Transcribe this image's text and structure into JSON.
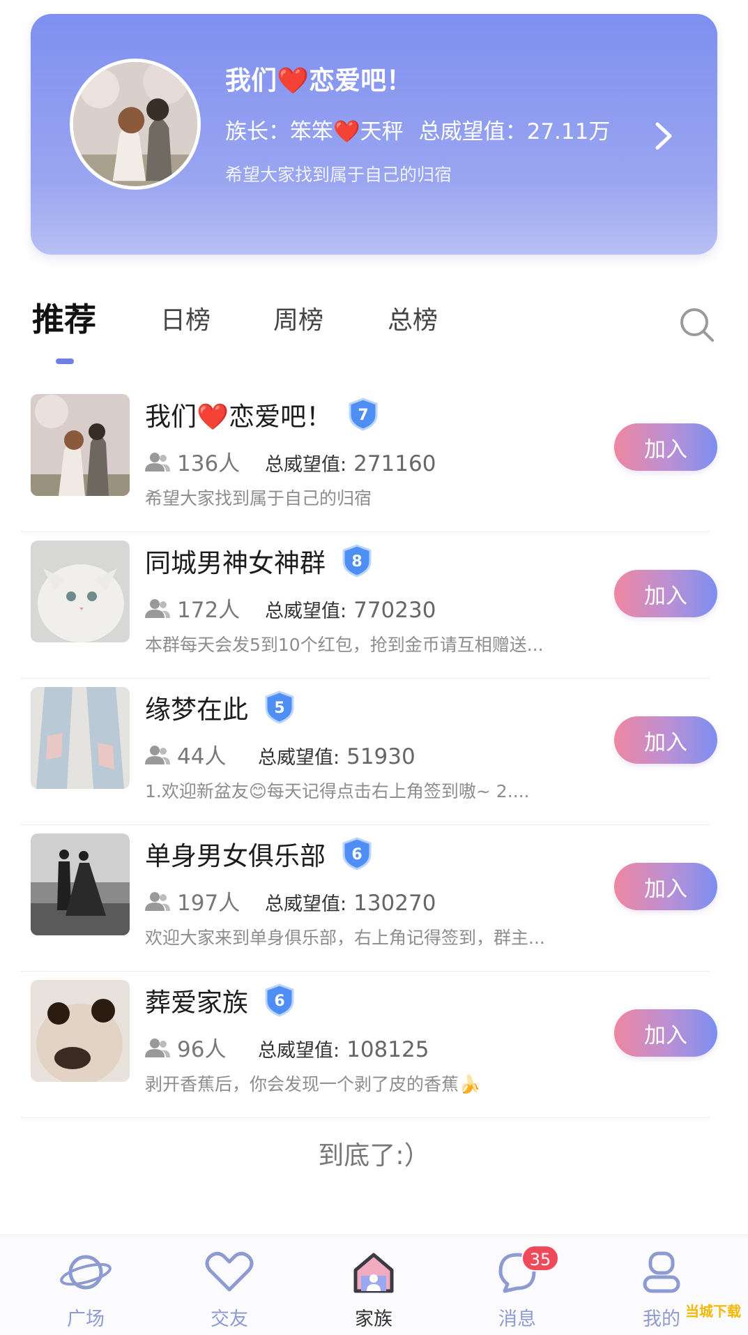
{
  "header": {
    "title": "我们❤️恋爱吧！",
    "leader": "族长：笨笨❤️天秤",
    "prestige": "总威望值：27.11万",
    "description": "希望大家找到属于自己的归宿"
  },
  "tabs": [
    {
      "label": "推荐",
      "active": true
    },
    {
      "label": "日榜",
      "active": false
    },
    {
      "label": "周榜",
      "active": false
    },
    {
      "label": "总榜",
      "active": false
    }
  ],
  "groups": [
    {
      "name": "我们❤️恋爱吧！",
      "level": "7",
      "members": "136人",
      "prestige_label": "总威望值:",
      "prestige": "271160",
      "description": "希望大家找到属于自己的归宿",
      "join_label": "加入"
    },
    {
      "name": "同城男神女神群",
      "level": "8",
      "members": "172人",
      "prestige_label": "总威望值:",
      "prestige": "770230",
      "description": "本群每天会发5到10个红包，抢到金币请互相赠送...",
      "join_label": "加入"
    },
    {
      "name": "缘梦在此",
      "level": "5",
      "members": "44人",
      "prestige_label": "总威望值:",
      "prestige": "51930",
      "description": "1.欢迎新盆友😊每天记得点击右上角签到嗷~ 2....",
      "join_label": "加入"
    },
    {
      "name": "单身男女俱乐部",
      "level": "6",
      "members": "197人",
      "prestige_label": "总威望值:",
      "prestige": "130270",
      "description": "欢迎大家来到单身俱乐部，右上角记得签到，群主...",
      "join_label": "加入"
    },
    {
      "name": "葬爱家族",
      "level": "6",
      "members": "96人",
      "prestige_label": "总威望值:",
      "prestige": "108125",
      "description": "剥开香蕉后，你会发现一个剥了皮的香蕉🍌",
      "join_label": "加入"
    }
  ],
  "list_end": "到底了:）",
  "nav": {
    "items": [
      {
        "label": "广场",
        "icon": "planet-icon"
      },
      {
        "label": "交友",
        "icon": "heart-icon"
      },
      {
        "label": "家族",
        "icon": "house-icon",
        "active": true
      },
      {
        "label": "消息",
        "icon": "chat-bubble-icon",
        "badge": "35"
      },
      {
        "label": "我的",
        "icon": "person-icon"
      }
    ]
  },
  "watermark": "当城下载",
  "colors": {
    "accent": "#6f7fe6",
    "header_gradient_top": "#7f8ff0",
    "badge_red": "#f04a5a",
    "join_pink": "#ef87a0"
  }
}
